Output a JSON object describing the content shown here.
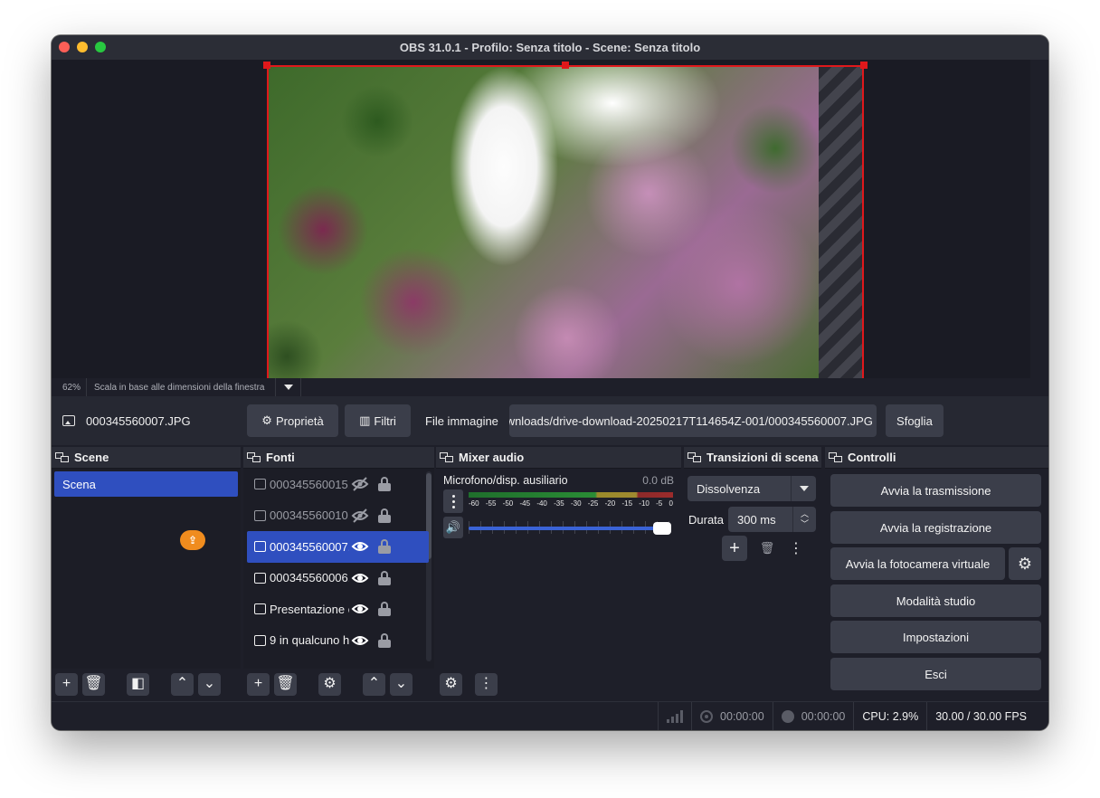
{
  "window": {
    "title": "OBS 31.0.1 - Profilo: Senza titolo - Scene: Senza titolo"
  },
  "preview": {
    "zoom": "62%",
    "scale_mode": "Scala in base alle dimensioni della finestra"
  },
  "source_toolbar": {
    "source_name": "000345560007.JPG",
    "properties_label": "Proprietà",
    "filters_label": "Filtri",
    "file_label": "File immagine",
    "file_path": "wnloads/drive-download-20250217T114654Z-001/000345560007.JPG",
    "browse_label": "Sfoglia"
  },
  "scenes": {
    "title": "Scene",
    "items": [
      "Scena"
    ]
  },
  "sources": {
    "title": "Fonti",
    "items": [
      {
        "name": "000345560015.",
        "visible": false,
        "selected": false
      },
      {
        "name": "000345560010.",
        "visible": false,
        "selected": false
      },
      {
        "name": "000345560007.",
        "visible": true,
        "selected": true
      },
      {
        "name": "000345560006.",
        "visible": true,
        "selected": false
      },
      {
        "name": "Presentazione c",
        "visible": true,
        "selected": false
      },
      {
        "name": "9 in qualcuno h",
        "visible": true,
        "selected": false
      }
    ]
  },
  "mixer": {
    "title": "Mixer audio",
    "track_name": "Microfono/disp. ausiliario",
    "track_level": "0.0 dB",
    "scale": [
      "-60",
      "-55",
      "-50",
      "-45",
      "-40",
      "-35",
      "-30",
      "-25",
      "-20",
      "-15",
      "-10",
      "-5",
      "0"
    ],
    "volume": 1.0
  },
  "transitions": {
    "title": "Transizioni di scena",
    "selected": "Dissolvenza",
    "duration_label": "Durata",
    "duration_value": "300 ms"
  },
  "controls": {
    "title": "Controlli",
    "start_stream": "Avvia la trasmissione",
    "start_record": "Avvia la registrazione",
    "start_virtualcam": "Avvia la fotocamera virtuale",
    "studio_mode": "Modalità studio",
    "settings": "Impostazioni",
    "exit": "Esci"
  },
  "status": {
    "stream_time": "00:00:00",
    "record_time": "00:00:00",
    "cpu": "CPU: 2.9%",
    "fps": "30.00 / 30.00 FPS"
  },
  "colors": {
    "accent_selection": "#2f4fbf",
    "preview_border": "#e0181b",
    "button_bg": "#3b3e4a"
  }
}
